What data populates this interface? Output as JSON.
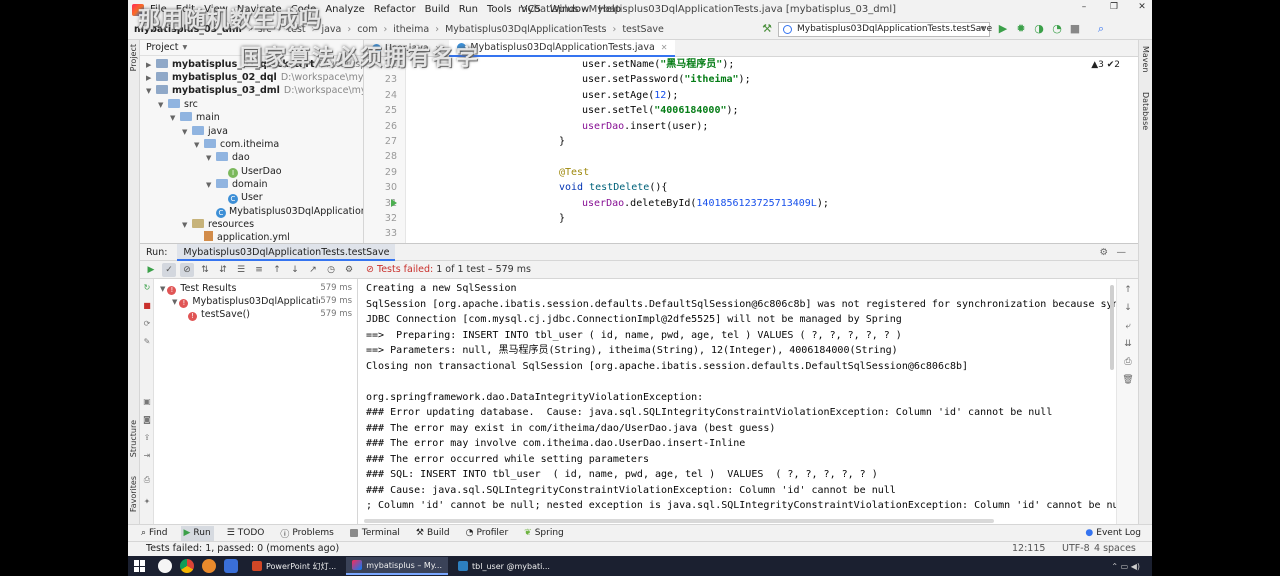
{
  "menubar": {
    "items": [
      "File",
      "Edit",
      "View",
      "Navigate",
      "Code",
      "Analyze",
      "Refactor",
      "Build",
      "Run",
      "Tools",
      "VCS",
      "Window",
      "Help"
    ],
    "window_title": "mybatisplus - Mybatisplus03DqlApplicationTests.java [mybatisplus_03_dml]"
  },
  "navbar": {
    "crumbs": [
      "mybatisplus_03_dml",
      "src",
      "test",
      "java",
      "com",
      "itheima",
      "Mybatisplus03DqlApplicationTests",
      "testSave"
    ],
    "run_config": "Mybatisplus03DqlApplicationTests.testSave"
  },
  "project": {
    "header": "Project",
    "rows": [
      {
        "label": "mybatisplus_01_quickstart",
        "path": "D:\\workspace\\mybatisplus"
      },
      {
        "label": "mybatisplus_02_dql",
        "path": "D:\\workspace\\mybatisp"
      },
      {
        "label": "mybatisplus_03_dml",
        "path": "D:\\workspace\\mybatisplu"
      },
      {
        "label": "src"
      },
      {
        "label": "main"
      },
      {
        "label": "java"
      },
      {
        "label": "com.itheima"
      },
      {
        "label": "dao"
      },
      {
        "label": "UserDao"
      },
      {
        "label": "domain"
      },
      {
        "label": "User"
      },
      {
        "label": "Mybatisplus03DqlApplication"
      },
      {
        "label": "resources"
      },
      {
        "label": "application.yml"
      }
    ]
  },
  "editor": {
    "tabs": [
      "User.java",
      "Mybatisplus03DqlApplicationTests.java"
    ],
    "warnings": "▲3 ✔2",
    "line_numbers": [
      "22",
      "23",
      "24",
      "25",
      "26",
      "27",
      "28",
      "29",
      "30",
      "31",
      "32",
      "33"
    ]
  },
  "run": {
    "label": "Run:",
    "tab": "Mybatisplus03DqlApplicationTests.testSave",
    "fail_label": "Tests failed:",
    "fail_detail": "1 of 1 test – 579 ms",
    "tree": [
      {
        "label": "Test Results",
        "time": "579 ms"
      },
      {
        "label": "Mybatisplus03DqlApplicationTe",
        "time": "579 ms"
      },
      {
        "label": "testSave()",
        "time": "579 ms"
      }
    ],
    "console": [
      "Creating a new SqlSession",
      "SqlSession [org.apache.ibatis.session.defaults.DefaultSqlSession@6c806c8b] was not registered for synchronization because synchr",
      "JDBC Connection [com.mysql.cj.jdbc.ConnectionImpl@2dfe5525] will not be managed by Spring",
      "==>  Preparing: INSERT INTO tbl_user ( id, name, pwd, age, tel ) VALUES ( ?, ?, ?, ?, ? )",
      "==> Parameters: null, 黑马程序员(String), itheima(String), 12(Integer), 4006184000(String)",
      "Closing non transactional SqlSession [org.apache.ibatis.session.defaults.DefaultSqlSession@6c806c8b]",
      "",
      "org.springframework.dao.DataIntegrityViolationException:",
      "### Error updating database.  Cause: java.sql.SQLIntegrityConstraintViolationException: Column 'id' cannot be null",
      "### The error may exist in com/itheima/dao/UserDao.java (best guess)",
      "### The error may involve com.itheima.dao.UserDao.insert-Inline",
      "### The error occurred while setting parameters",
      "### SQL: INSERT INTO tbl_user  ( id, name, pwd, age, tel )  VALUES  ( ?, ?, ?, ?, ? )",
      "### Cause: java.sql.SQLIntegrityConstraintViolationException: Column 'id' cannot be null",
      "; Column 'id' cannot be null; nested exception is java.sql.SQLIntegrityConstraintViolationException: Column 'id' cannot be null"
    ]
  },
  "code": {
    "l22_a": "user.setName(",
    "l22_str": "\"黑马程序员\"",
    "l22_b": ");",
    "l23_a": "user.setPassword(",
    "l23_str": "\"itheima\"",
    "l23_b": ");",
    "l24_a": "user.setAge(",
    "l24_num": "12",
    "l24_b": ");",
    "l25_a": "user.setTel(",
    "l25_str": "\"4006184000\"",
    "l25_b": ");",
    "l26_fld": "userDao",
    "l26_b": ".insert(user);",
    "l27": "}",
    "l29_ann": "@Test",
    "l30_kw": "void ",
    "l30_fn": "testDelete",
    "l30_b": "(){",
    "l31_fld": "userDao",
    "l31_b": ".deleteById(",
    "l31_num": "1401856123725713409L",
    "l31_c": ");",
    "l32": "}"
  },
  "bottombar": {
    "tools": [
      "Find",
      "Run",
      "TODO",
      "Problems",
      "Terminal",
      "Build",
      "Profiler",
      "Spring"
    ],
    "event_log": "Event Log"
  },
  "statusbar": {
    "text": "Tests failed: 1, passed: 0 (moments ago)",
    "position": "12:115",
    "encoding": "UTF-8",
    "indent": "4 spaces"
  },
  "left_strip": {
    "project": "Project",
    "structure": "Structure",
    "favorites": "Favorites"
  },
  "right_strip": {
    "maven": "Maven",
    "database": "Database"
  },
  "overlay": {
    "line1": "那用随机数生成吗",
    "line2": "国家算法必须拥有名字"
  },
  "taskbar": {
    "items": [
      "PowerPoint 幻灯...",
      "mybatisplus – My...",
      "tbl_user @mybati..."
    ]
  },
  "colors": {
    "accent": "#3574f0",
    "error": "#c9302c",
    "string": "#067d17",
    "keyword": "#0033b3"
  }
}
